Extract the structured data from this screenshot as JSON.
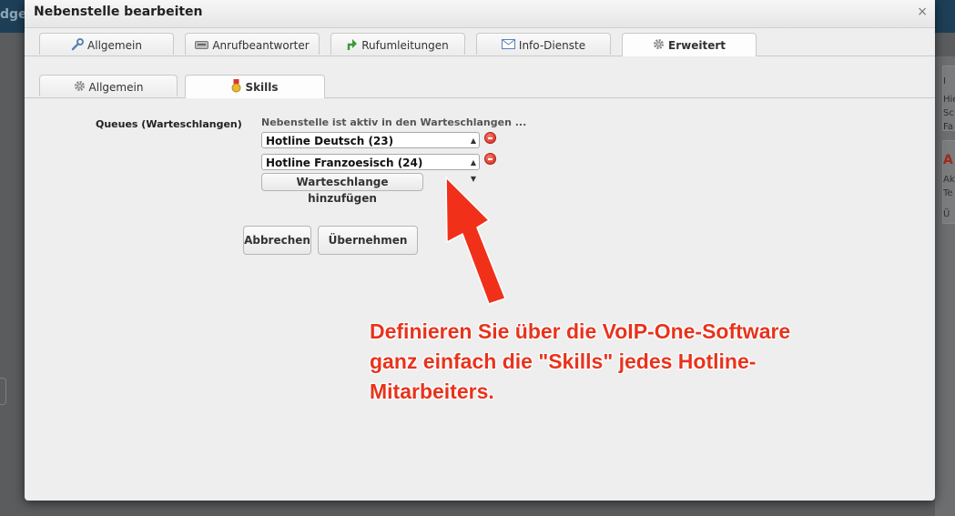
{
  "background": {
    "logo_fragment": "dge",
    "right_panel_fragments": [
      "I",
      "Hie",
      "Sc",
      "Fa",
      "A",
      "Ak",
      "Te",
      "Ü"
    ]
  },
  "dialog": {
    "title": "Nebenstelle bearbeiten",
    "close_glyph": "×"
  },
  "tabs_main": [
    {
      "label": "Allgemein",
      "icon": "wrench-icon"
    },
    {
      "label": "Anrufbeantworter",
      "icon": "answering-machine-icon"
    },
    {
      "label": "Rufumleitungen",
      "icon": "forward-arrow-icon"
    },
    {
      "label": "Info-Dienste",
      "icon": "envelope-icon"
    },
    {
      "label": "Erweitert",
      "icon": "gear-icon",
      "active": true
    }
  ],
  "tabs_sub": [
    {
      "label": "Allgemein",
      "icon": "gear-icon"
    },
    {
      "label": "Skills",
      "icon": "medal-icon",
      "active": true
    }
  ],
  "form": {
    "queues_label": "Queues (Warteschlangen)",
    "queues_hint": "Nebenstelle ist aktiv in den Warteschlangen ...",
    "queues": [
      {
        "value": "Hotline Deutsch (23)"
      },
      {
        "value": "Hotline Franzoesisch (24)"
      }
    ],
    "add_queue_label": "Warteschlange hinzufügen",
    "cancel_label": "Abbrechen",
    "apply_label": "Übernehmen"
  },
  "annotation": {
    "lines": [
      "Definieren Sie über die VoIP-One-Software",
      "ganz einfach die \"Skills\" jedes Hotline-",
      "Mitarbeiters."
    ],
    "color": "#e8331c"
  }
}
